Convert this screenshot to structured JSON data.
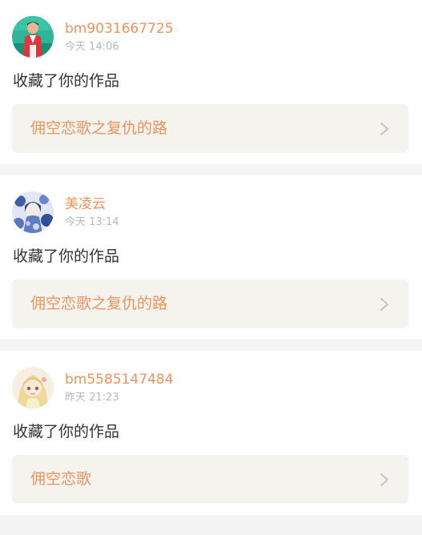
{
  "notifications": [
    {
      "username": "bm9031667725",
      "time": "今天 14:06",
      "action": "收藏了你的作品",
      "work_title": "佣空恋歌之复仇的路",
      "avatar_icon": "avatar-man-red-jacket"
    },
    {
      "username": "美凌云",
      "time": "今天 13:14",
      "action": "收藏了你的作品",
      "work_title": "佣空恋歌之复仇的路",
      "avatar_icon": "avatar-anime-blue-floral"
    },
    {
      "username": "bm5585147484",
      "time": "昨天 21:23",
      "action": "收藏了你的作品",
      "work_title": "佣空恋歌",
      "avatar_icon": "avatar-anime-blonde-girl"
    }
  ],
  "colors": {
    "accent": "#f0935a",
    "page_bg": "#f4f4f4",
    "card_bg": "#ffffff",
    "link_bg": "#f4f3ee",
    "secondary_text": "#b8b8b8",
    "primary_text": "#333333"
  }
}
